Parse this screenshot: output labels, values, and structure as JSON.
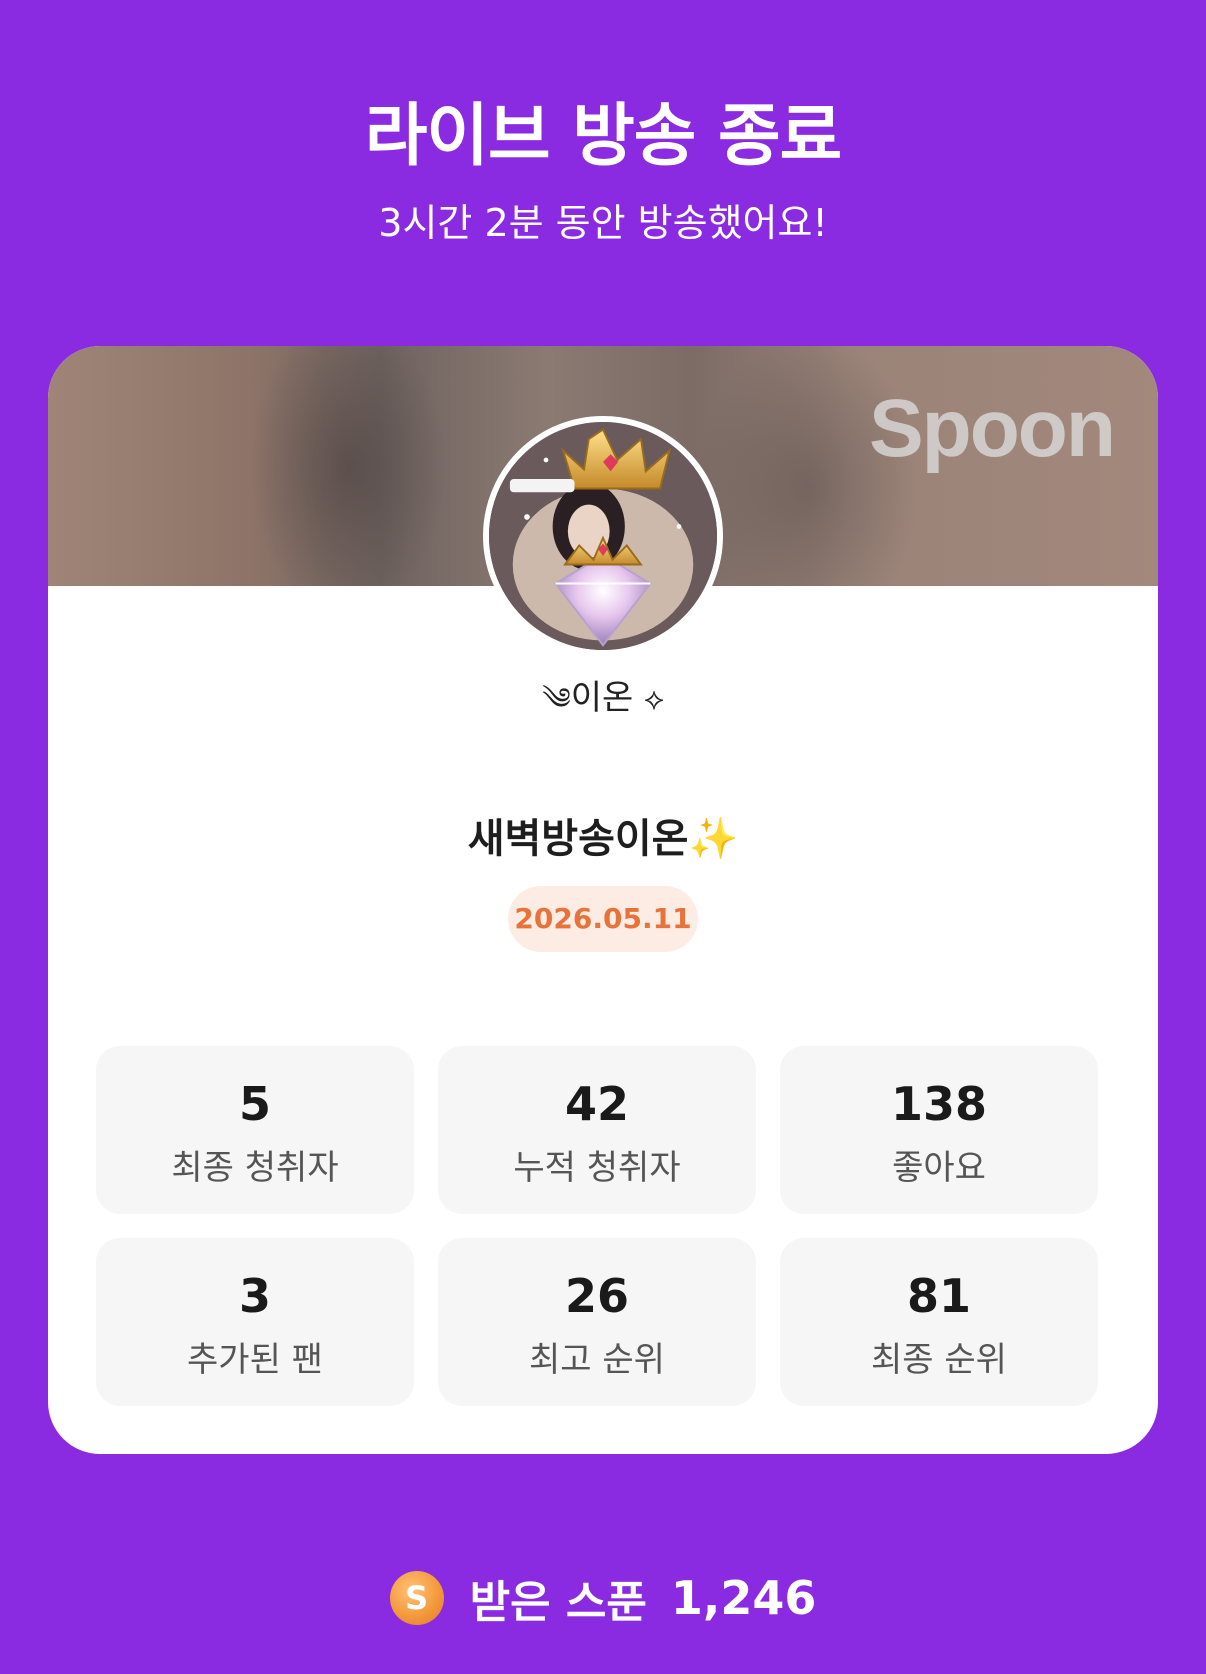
{
  "header": {
    "title": "라이브 방송 종료",
    "subtitle": "3시간 2분 동안 방송했어요!"
  },
  "card": {
    "brand_watermark": "Spoon",
    "nickname_prefix": "༄",
    "nickname": "이온",
    "nickname_suffix": "⟡",
    "room_title": "새벽방송이온",
    "room_title_emoji": "✨",
    "date": "2026.05.11",
    "stats": [
      {
        "value": "5",
        "label": "최종 청취자"
      },
      {
        "value": "42",
        "label": "누적 청취자"
      },
      {
        "value": "138",
        "label": "좋아요"
      },
      {
        "value": "3",
        "label": "추가된 팬"
      },
      {
        "value": "26",
        "label": "최고 순위"
      },
      {
        "value": "81",
        "label": "최종 순위"
      }
    ]
  },
  "footer": {
    "coin_icon_letter": "S",
    "spoon_label": "받은 스푼",
    "spoon_value": "1,246"
  },
  "colors": {
    "background": "#8a2be2",
    "date_text": "#e8733a",
    "date_badge_bg": "#fdece4",
    "coin": "#f39a3b"
  },
  "icons": {
    "coin": "spoon-coin-icon",
    "avatar": "profile-avatar-image"
  }
}
